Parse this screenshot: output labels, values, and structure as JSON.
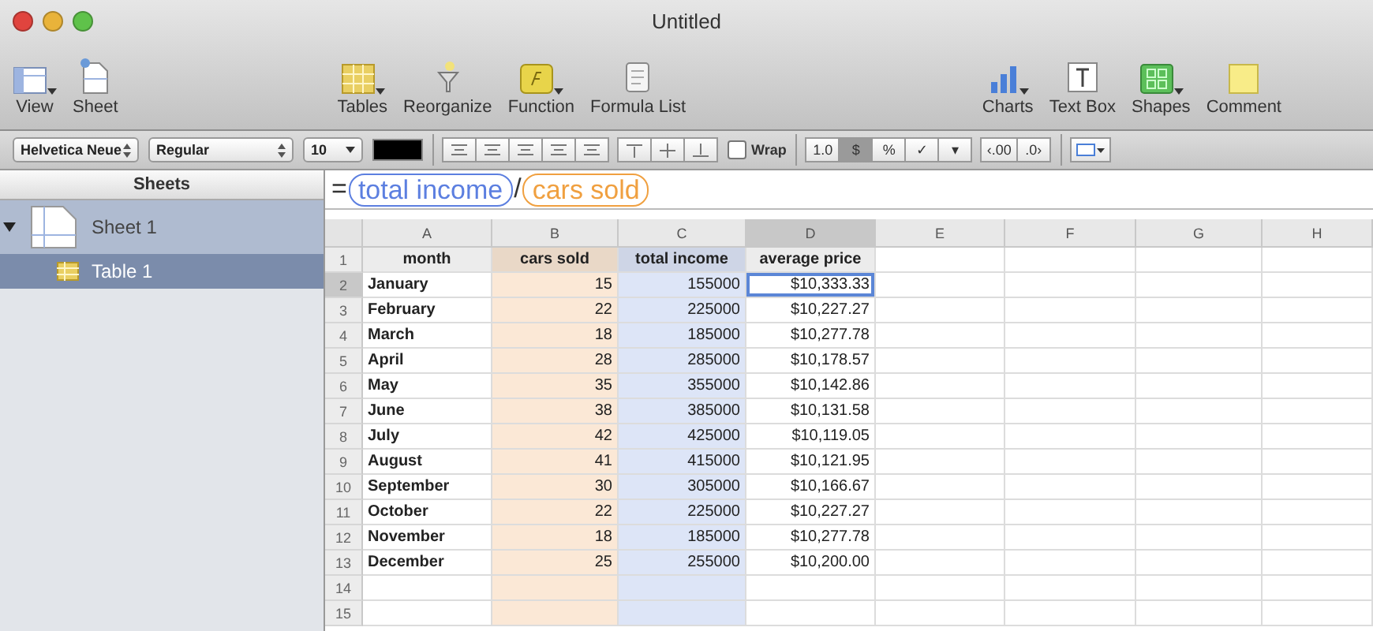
{
  "window": {
    "title": "Untitled"
  },
  "toolbar": {
    "groups": [
      [
        {
          "label": "View",
          "kind": "view",
          "menu": true
        },
        {
          "label": "Sheet",
          "kind": "sheet",
          "menu": false
        }
      ],
      [
        {
          "label": "Tables",
          "kind": "tables",
          "menu": true
        },
        {
          "label": "Reorganize",
          "kind": "reorganize",
          "menu": false
        },
        {
          "label": "Function",
          "kind": "function",
          "menu": true
        },
        {
          "label": "Formula List",
          "kind": "formulalist",
          "menu": false
        }
      ],
      [
        {
          "label": "Charts",
          "kind": "charts",
          "menu": true
        },
        {
          "label": "Text Box",
          "kind": "textbox",
          "menu": false
        },
        {
          "label": "Shapes",
          "kind": "shapes",
          "menu": true
        },
        {
          "label": "Comment",
          "kind": "comment",
          "menu": false
        }
      ]
    ]
  },
  "format_bar": {
    "font": "Helvetica Neue",
    "style": "Regular",
    "size": "10",
    "wrap": {
      "label": "Wrap",
      "checked": false
    },
    "number_buttons": [
      {
        "label": "1.0",
        "selected": false
      },
      {
        "label": "$",
        "selected": true
      },
      {
        "label": "%",
        "selected": false
      },
      {
        "label": "✓",
        "selected": false
      },
      {
        "label": "▾",
        "selected": false
      }
    ],
    "decimal_buttons": [
      "‹.00",
      ".0›"
    ]
  },
  "sidebar": {
    "title": "Sheets",
    "items": [
      {
        "label": "Sheet 1",
        "expanded": true,
        "selected": false,
        "children": [
          {
            "label": "Table 1",
            "selected": true
          }
        ]
      }
    ]
  },
  "formula": [
    {
      "kind": "operator",
      "text": "="
    },
    {
      "kind": "reference",
      "text": "total income",
      "color": "#5c7fe0"
    },
    {
      "kind": "operator",
      "text": "/"
    },
    {
      "kind": "reference",
      "text": "cars sold",
      "color": "#f0a040"
    }
  ],
  "table": {
    "columns": [
      {
        "label": "A",
        "selected": false
      },
      {
        "label": "B",
        "selected": false,
        "color": "#fbe8d6"
      },
      {
        "label": "C",
        "selected": false,
        "color": "#dde5f7"
      },
      {
        "label": "D",
        "selected": true
      },
      {
        "label": "E",
        "selected": false
      },
      {
        "label": "F",
        "selected": false
      },
      {
        "label": "G",
        "selected": false
      },
      {
        "label": "H",
        "selected": false
      }
    ],
    "rows": [
      {
        "number": "1",
        "selected": false,
        "cells": [
          "month",
          "cars sold",
          "total income",
          "average price"
        ]
      },
      {
        "number": "2",
        "selected": true,
        "cells": [
          "January",
          "15",
          "155000",
          "$10,333.33"
        ]
      },
      {
        "number": "3",
        "selected": false,
        "cells": [
          "February",
          "22",
          "225000",
          "$10,227.27"
        ]
      },
      {
        "number": "4",
        "selected": false,
        "cells": [
          "March",
          "18",
          "185000",
          "$10,277.78"
        ]
      },
      {
        "number": "5",
        "selected": false,
        "cells": [
          "April",
          "28",
          "285000",
          "$10,178.57"
        ]
      },
      {
        "number": "6",
        "selected": false,
        "cells": [
          "May",
          "35",
          "355000",
          "$10,142.86"
        ]
      },
      {
        "number": "7",
        "selected": false,
        "cells": [
          "June",
          "38",
          "385000",
          "$10,131.58"
        ]
      },
      {
        "number": "8",
        "selected": false,
        "cells": [
          "July",
          "42",
          "425000",
          "$10,119.05"
        ]
      },
      {
        "number": "9",
        "selected": false,
        "cells": [
          "August",
          "41",
          "415000",
          "$10,121.95"
        ]
      },
      {
        "number": "10",
        "selected": false,
        "cells": [
          "September",
          "30",
          "305000",
          "$10,166.67"
        ]
      },
      {
        "number": "11",
        "selected": false,
        "cells": [
          "October",
          "22",
          "225000",
          "$10,227.27"
        ]
      },
      {
        "number": "12",
        "selected": false,
        "cells": [
          "November",
          "18",
          "185000",
          "$10,277.78"
        ]
      },
      {
        "number": "13",
        "selected": false,
        "cells": [
          "December",
          "25",
          "255000",
          "$10,200.00"
        ]
      },
      {
        "number": "14",
        "selected": false,
        "cells": []
      },
      {
        "number": "15",
        "selected": false,
        "cells": []
      }
    ]
  }
}
